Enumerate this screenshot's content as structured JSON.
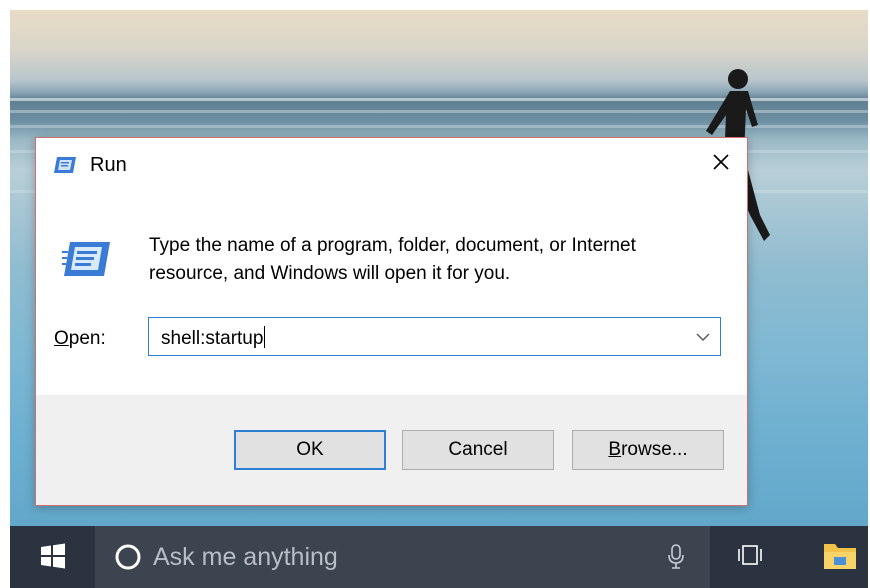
{
  "dialog": {
    "title": "Run",
    "close_glyph": "✕",
    "description_line1": "Type the name of a program, folder, document, or Internet",
    "description_line2": "resource, and Windows will open it for you.",
    "open_label_mnemonic": "O",
    "open_label_rest": "pen:",
    "open_value": "shell:startup",
    "ok_label": "OK",
    "cancel_label": "Cancel",
    "browse_mnemonic": "B",
    "browse_rest": "rowse...",
    "icons": {
      "title": "run-icon",
      "main": "run-icon",
      "dropdown": "chevron-down-icon",
      "close": "close-icon"
    }
  },
  "taskbar": {
    "search_placeholder": "Ask me anything",
    "icons": [
      "windows-start-icon",
      "cortana-icon",
      "microphone-icon",
      "task-view-icon",
      "file-explorer-icon"
    ]
  },
  "colors": {
    "accent": "#2c7fd2",
    "taskbar": "#2b3340",
    "dialog_border": "#d06f6f"
  }
}
